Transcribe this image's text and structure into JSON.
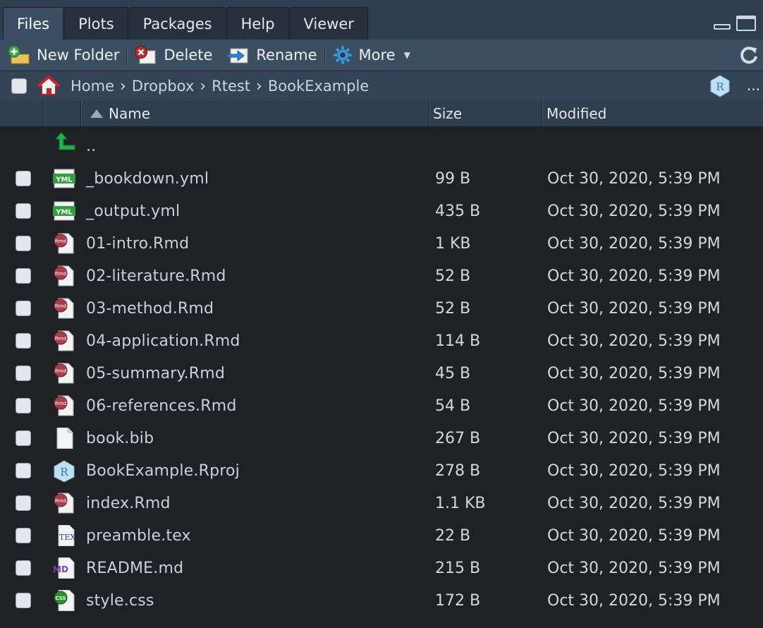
{
  "tabs": [
    {
      "label": "Files",
      "active": true
    },
    {
      "label": "Plots",
      "active": false
    },
    {
      "label": "Packages",
      "active": false
    },
    {
      "label": "Help",
      "active": false
    },
    {
      "label": "Viewer",
      "active": false
    }
  ],
  "toolbar": {
    "new_folder": "New Folder",
    "delete": "Delete",
    "rename": "Rename",
    "more": "More"
  },
  "breadcrumb": {
    "items": [
      "Home",
      "Dropbox",
      "Rtest",
      "BookExample"
    ],
    "more": "..."
  },
  "columns": {
    "name": "Name",
    "size": "Size",
    "modified": "Modified",
    "sort": "ascending"
  },
  "parent_dir": "..",
  "files": [
    {
      "name": "_bookdown.yml",
      "size": "99 B",
      "modified": "Oct 30, 2020, 5:39 PM",
      "icon": "yml-file-icon"
    },
    {
      "name": "_output.yml",
      "size": "435 B",
      "modified": "Oct 30, 2020, 5:39 PM",
      "icon": "yml-file-icon"
    },
    {
      "name": "01-intro.Rmd",
      "size": "1 KB",
      "modified": "Oct 30, 2020, 5:39 PM",
      "icon": "rmd-file-icon"
    },
    {
      "name": "02-literature.Rmd",
      "size": "52 B",
      "modified": "Oct 30, 2020, 5:39 PM",
      "icon": "rmd-file-icon"
    },
    {
      "name": "03-method.Rmd",
      "size": "52 B",
      "modified": "Oct 30, 2020, 5:39 PM",
      "icon": "rmd-file-icon"
    },
    {
      "name": "04-application.Rmd",
      "size": "114 B",
      "modified": "Oct 30, 2020, 5:39 PM",
      "icon": "rmd-file-icon"
    },
    {
      "name": "05-summary.Rmd",
      "size": "45 B",
      "modified": "Oct 30, 2020, 5:39 PM",
      "icon": "rmd-file-icon"
    },
    {
      "name": "06-references.Rmd",
      "size": "54 B",
      "modified": "Oct 30, 2020, 5:39 PM",
      "icon": "rmd-file-icon"
    },
    {
      "name": "book.bib",
      "size": "267 B",
      "modified": "Oct 30, 2020, 5:39 PM",
      "icon": "text-file-icon"
    },
    {
      "name": "BookExample.Rproj",
      "size": "278 B",
      "modified": "Oct 30, 2020, 5:39 PM",
      "icon": "rproj-file-icon"
    },
    {
      "name": "index.Rmd",
      "size": "1.1 KB",
      "modified": "Oct 30, 2020, 5:39 PM",
      "icon": "rmd-file-icon"
    },
    {
      "name": "preamble.tex",
      "size": "22 B",
      "modified": "Oct 30, 2020, 5:39 PM",
      "icon": "tex-file-icon"
    },
    {
      "name": "README.md",
      "size": "215 B",
      "modified": "Oct 30, 2020, 5:39 PM",
      "icon": "md-file-icon"
    },
    {
      "name": "style.css",
      "size": "172 B",
      "modified": "Oct 30, 2020, 5:39 PM",
      "icon": "css-file-icon"
    }
  ],
  "colors": {
    "background": "#1f2125",
    "tabbar": "#2f3e4e",
    "toolbar": "#3c4e61",
    "filename_text": "#c7d0dd",
    "rmd_icon": "#a83d4a",
    "yml_icon": "#2e9e3e",
    "css_icon": "#2b8f2b",
    "md_icon": "#7a3fa8",
    "up_arrow": "#22b04a"
  }
}
